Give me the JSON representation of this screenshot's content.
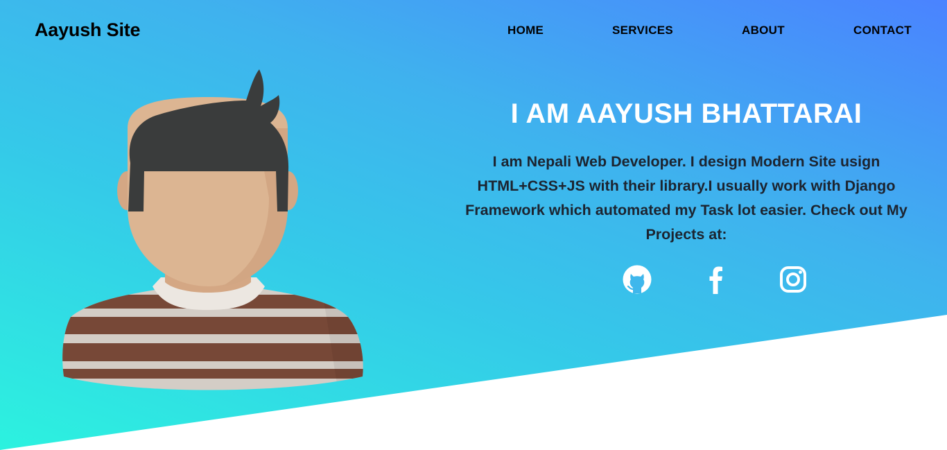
{
  "site": {
    "brand": "Aayush Site"
  },
  "nav": {
    "items": [
      "HOME",
      "SERVICES",
      "ABOUT",
      "CONTACT"
    ]
  },
  "hero": {
    "title": "I AM AAYUSH BHATTARAI",
    "bio": "I am Nepali Web Developer. I design Modern Site usign HTML+CSS+JS with their library.I usually work with Django Framework which automated my Task lot easier. Check out My Projects at:"
  },
  "social": {
    "icons": [
      "github-icon",
      "facebook-icon",
      "instagram-icon"
    ]
  },
  "colors": {
    "gradient_start": "#2cf2df",
    "gradient_end": "#4a83ff",
    "title": "#ffffff",
    "text": "#1c2430"
  }
}
